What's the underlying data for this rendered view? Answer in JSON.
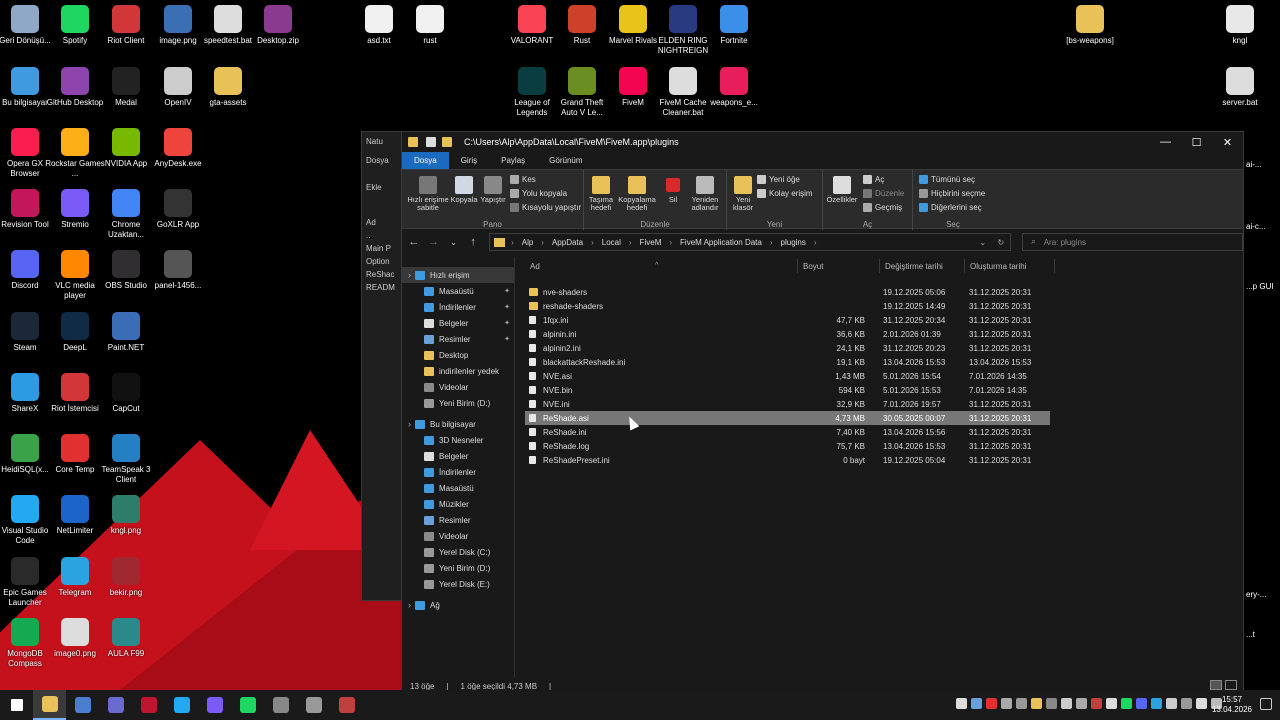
{
  "desktop": {
    "icons": [
      {
        "label": "Geri Dönüşü...",
        "color": "#8fa8c8"
      },
      {
        "label": "Spotify",
        "color": "#1ed760"
      },
      {
        "label": "Riot Client",
        "color": "#d13639"
      },
      {
        "label": "image.png",
        "color": "#3a6fb3"
      },
      {
        "label": "speedtest.bat",
        "color": "#dddddd"
      },
      {
        "label": "Desktop.zip",
        "color": "#8a3b8f"
      },
      {
        "label": "asd.txt",
        "color": "#f0f0f0"
      },
      {
        "label": "rust",
        "color": "#f0f0f0"
      },
      {
        "label": "VALORANT",
        "color": "#fa4454"
      },
      {
        "label": "Rust",
        "color": "#cd412b"
      },
      {
        "label": "Marvel Rivals",
        "color": "#e8c31a"
      },
      {
        "label": "ELDEN RING NIGHTREIGN",
        "color": "#2a3a80"
      },
      {
        "label": "Fortnite",
        "color": "#3c8fe8"
      },
      {
        "label": "[bs-weapons]",
        "color": "#e8c158"
      },
      {
        "label": "kngl",
        "color": "#e8e8e8"
      },
      {
        "label": "Bu bilgisayar",
        "color": "#3f9ae0"
      },
      {
        "label": "GitHub Desktop",
        "color": "#8e44ad"
      },
      {
        "label": "Medal",
        "color": "#222222"
      },
      {
        "label": "OpenIV",
        "color": "#cccccc"
      },
      {
        "label": "gta-assets",
        "color": "#e8c158"
      },
      {
        "label": "League of Legends",
        "color": "#0a3d3f"
      },
      {
        "label": "Grand Theft Auto V Le...",
        "color": "#6b8e23"
      },
      {
        "label": "FiveM",
        "color": "#f40552"
      },
      {
        "label": "FiveM Cache Cleaner.bat",
        "color": "#dddddd"
      },
      {
        "label": "weapons_e...",
        "color": "#e81d5b"
      },
      {
        "label": "server.bat",
        "color": "#dddddd"
      },
      {
        "label": "Opera GX Browser",
        "color": "#fa1e4e"
      },
      {
        "label": "Rockstar Games ...",
        "color": "#fcaf17"
      },
      {
        "label": "NVIDIA App",
        "color": "#76b900"
      },
      {
        "label": "AnyDesk.exe",
        "color": "#ef443b"
      },
      {
        "label": "Revision Tool",
        "color": "#c2185b"
      },
      {
        "label": "Stremio",
        "color": "#7b5bf5"
      },
      {
        "label": "Chrome Uzaktan...",
        "color": "#4285f4"
      },
      {
        "label": "GoXLR App",
        "color": "#333333"
      },
      {
        "label": "Discord",
        "color": "#5865f2"
      },
      {
        "label": "VLC media player",
        "color": "#ff8800"
      },
      {
        "label": "OBS Studio",
        "color": "#302e31"
      },
      {
        "label": "panel-1456...",
        "color": "#555555"
      },
      {
        "label": "Steam",
        "color": "#1b2838"
      },
      {
        "label": "DeepL",
        "color": "#0f2b46"
      },
      {
        "label": "Paint.NET",
        "color": "#3b6cb6"
      },
      {
        "label": "ShareX",
        "color": "#2c9be4"
      },
      {
        "label": "Riot İstemcisi",
        "color": "#d13639"
      },
      {
        "label": "CapCut",
        "color": "#111111"
      },
      {
        "label": "HeidiSQL(x...",
        "color": "#3aa34a"
      },
      {
        "label": "Core Temp",
        "color": "#e03030"
      },
      {
        "label": "TeamSpeak 3 Client",
        "color": "#2580c3"
      },
      {
        "label": "Visual Studio Code",
        "color": "#23a9f2"
      },
      {
        "label": "NetLimiter",
        "color": "#1c64c8"
      },
      {
        "label": "kngl.png",
        "color": "#2e7d6b"
      },
      {
        "label": "Epic Games Launcher",
        "color": "#2a2a2a"
      },
      {
        "label": "Telegram",
        "color": "#2aa3e0"
      },
      {
        "label": "bekir.png",
        "color": "#a02830"
      },
      {
        "label": "MongoDB Compass",
        "color": "#13aa52"
      },
      {
        "label": "image0.png",
        "color": "#dddddd"
      },
      {
        "label": "AULA F99",
        "color": "#2a8a8a"
      }
    ],
    "right_partial_labels": [
      "ai-...",
      "ai-c...",
      "...p GUI",
      "ery-...",
      "...t"
    ]
  },
  "bg_window": {
    "title": "Natu",
    "menu": "Dosya",
    "add": "Ekle",
    "col": "Ad",
    "items": [
      "..",
      "Main P",
      "Option",
      "ReShac",
      "READM"
    ]
  },
  "window": {
    "title_path": "C:\\Users\\Alp\\AppData\\Local\\FiveM\\FiveM.app\\plugins",
    "controls": {
      "minimize": "—",
      "maximize": "☐",
      "close": "✕"
    },
    "tabs": [
      "Dosya",
      "Giriş",
      "Paylaş",
      "Görünüm"
    ],
    "ribbon": {
      "pano": {
        "label": "Pano",
        "pin": "Hızlı erişime sabitle",
        "copy": "Kopyala",
        "paste": "Yapıştır",
        "cut": "Kes",
        "copy_path": "Yolu kopyala",
        "paste_shortcut": "Kısayolu yapıştır"
      },
      "duzenle": {
        "label": "Düzenle",
        "move_to": "Taşıma hedefi",
        "copy_to": "Kopyalama hedefi",
        "delete": "Sil",
        "rename": "Yeniden adlandır"
      },
      "yeni": {
        "label": "Yeni",
        "new_folder": "Yeni klasör",
        "new_item": "Yeni öğe",
        "easy_access": "Kolay erişim"
      },
      "ac": {
        "label": "Aç",
        "properties": "Özellikler",
        "open": "Aç",
        "edit": "Düzenle",
        "history": "Geçmiş"
      },
      "sec": {
        "label": "Seç",
        "select_all": "Tümünü seç",
        "select_none": "Hiçbirini seçme",
        "invert": "Diğerlerini seç"
      }
    },
    "breadcrumb": [
      "Alp",
      "AppData",
      "Local",
      "FiveM",
      "FiveM Application Data",
      "plugins"
    ],
    "search_placeholder": "Ara: plugins",
    "nav": [
      {
        "label": "Hızlı erişim",
        "color": "#3f9ae0",
        "indent": 0,
        "pin": false,
        "sel": true
      },
      {
        "label": "Masaüstü",
        "color": "#3f9ae0",
        "indent": 1,
        "pin": true
      },
      {
        "label": "İndirilenler",
        "color": "#3f9ae0",
        "indent": 1,
        "pin": true
      },
      {
        "label": "Belgeler",
        "color": "#dddddd",
        "indent": 1,
        "pin": true
      },
      {
        "label": "Resimler",
        "color": "#6aa0d8",
        "indent": 1,
        "pin": true
      },
      {
        "label": "Desktop",
        "color": "#e8c158",
        "indent": 1,
        "pin": false
      },
      {
        "label": "indirilenler yedek",
        "color": "#e8c158",
        "indent": 1,
        "pin": false
      },
      {
        "label": "Videolar",
        "color": "#8a8a8a",
        "indent": 1,
        "pin": false
      },
      {
        "label": "Yeni Birim (D:)",
        "color": "#999999",
        "indent": 1,
        "pin": false
      },
      {
        "label": "",
        "color": "",
        "indent": 0,
        "pin": false,
        "spacer": true
      },
      {
        "label": "Bu bilgisayar",
        "color": "#3f9ae0",
        "indent": 0,
        "pin": false
      },
      {
        "label": "3D Nesneler",
        "color": "#3f9ae0",
        "indent": 1,
        "pin": false
      },
      {
        "label": "Belgeler",
        "color": "#dddddd",
        "indent": 1,
        "pin": false
      },
      {
        "label": "İndirilenler",
        "color": "#3f9ae0",
        "indent": 1,
        "pin": false
      },
      {
        "label": "Masaüstü",
        "color": "#3f9ae0",
        "indent": 1,
        "pin": false
      },
      {
        "label": "Müzikler",
        "color": "#3f9ae0",
        "indent": 1,
        "pin": false
      },
      {
        "label": "Resimler",
        "color": "#6aa0d8",
        "indent": 1,
        "pin": false
      },
      {
        "label": "Videolar",
        "color": "#8a8a8a",
        "indent": 1,
        "pin": false
      },
      {
        "label": "Yerel Disk (C:)",
        "color": "#999999",
        "indent": 1,
        "pin": false
      },
      {
        "label": "Yeni Birim (D:)",
        "color": "#999999",
        "indent": 1,
        "pin": false
      },
      {
        "label": "Yerel Disk (E:)",
        "color": "#999999",
        "indent": 1,
        "pin": false
      },
      {
        "label": "",
        "color": "",
        "indent": 0,
        "pin": false,
        "spacer": true
      },
      {
        "label": "Ağ",
        "color": "#3f9ae0",
        "indent": 0,
        "pin": false
      }
    ],
    "columns": {
      "name": "Ad",
      "size": "Boyut",
      "modified": "Değiştirme tarihi",
      "created": "Oluşturma tarihi"
    },
    "files": [
      {
        "name": "nve-shaders",
        "type": "folder",
        "size": "",
        "modified": "19.12.2025 05:06",
        "created": "31.12.2025 20:31"
      },
      {
        "name": "reshade-shaders",
        "type": "folder",
        "size": "",
        "modified": "19.12.2025 14:49",
        "created": "31.12.2025 20:31"
      },
      {
        "name": "1fqx.ini",
        "type": "file",
        "size": "47,7 KB",
        "modified": "31.12.2025 20:34",
        "created": "31.12.2025 20:31"
      },
      {
        "name": "alpinin.ini",
        "type": "file",
        "size": "36,6 KB",
        "modified": "2.01.2026 01:39",
        "created": "31.12.2025 20:31"
      },
      {
        "name": "alpinin2.ini",
        "type": "file",
        "size": "24,1 KB",
        "modified": "31.12.2025 20:23",
        "created": "31.12.2025 20:31"
      },
      {
        "name": "blackattackReshade.ini",
        "type": "file",
        "size": "19,1 KB",
        "modified": "13.04.2026 15:53",
        "created": "13.04.2026 15:53"
      },
      {
        "name": "NVE.asi",
        "type": "file",
        "size": "1,43 MB",
        "modified": "5.01.2026 15:54",
        "created": "7.01.2026 14:35"
      },
      {
        "name": "NVE.bin",
        "type": "file",
        "size": "594 KB",
        "modified": "5.01.2026 15:53",
        "created": "7.01.2026 14:35"
      },
      {
        "name": "NVE.ini",
        "type": "file",
        "size": "32,9 KB",
        "modified": "7.01.2026 19:57",
        "created": "31.12.2025 20:31"
      },
      {
        "name": "ReShade.asi",
        "type": "file",
        "size": "4,73 MB",
        "modified": "30.05.2025 00:07",
        "created": "31.12.2025 20:31",
        "selected": true
      },
      {
        "name": "ReShade.ini",
        "type": "file",
        "size": "7,40 KB",
        "modified": "13.04.2026 15:56",
        "created": "31.12.2025 20:31"
      },
      {
        "name": "ReShade.log",
        "type": "file",
        "size": "75,7 KB",
        "modified": "13.04.2026 15:53",
        "created": "31.12.2025 20:31"
      },
      {
        "name": "ReShadePreset.ini",
        "type": "file",
        "size": "0 bayt",
        "modified": "19.12.2025 05:04",
        "created": "31.12.2025 20:31"
      }
    ],
    "status": {
      "count": "13 öğe",
      "selection": "1 öğe seçildi 4,73 MB"
    }
  },
  "taskbar": {
    "apps": [
      {
        "name": "start",
        "color": "#ffffff"
      },
      {
        "name": "file-explorer",
        "color": "#e8c158",
        "active": true
      },
      {
        "name": "app-2",
        "color": "#4a7fd0"
      },
      {
        "name": "app-3",
        "color": "#6a6ad0"
      },
      {
        "name": "app-4",
        "color": "#c01530"
      },
      {
        "name": "vscode",
        "color": "#23a9f2"
      },
      {
        "name": "app-6",
        "color": "#7b5bf5"
      },
      {
        "name": "spotify",
        "color": "#1ed760"
      },
      {
        "name": "app-8",
        "color": "#888888"
      },
      {
        "name": "app-9",
        "color": "#999999"
      },
      {
        "name": "app-10",
        "color": "#c04040"
      }
    ],
    "clock_time": "15:57",
    "clock_date": "13.04.2026"
  }
}
